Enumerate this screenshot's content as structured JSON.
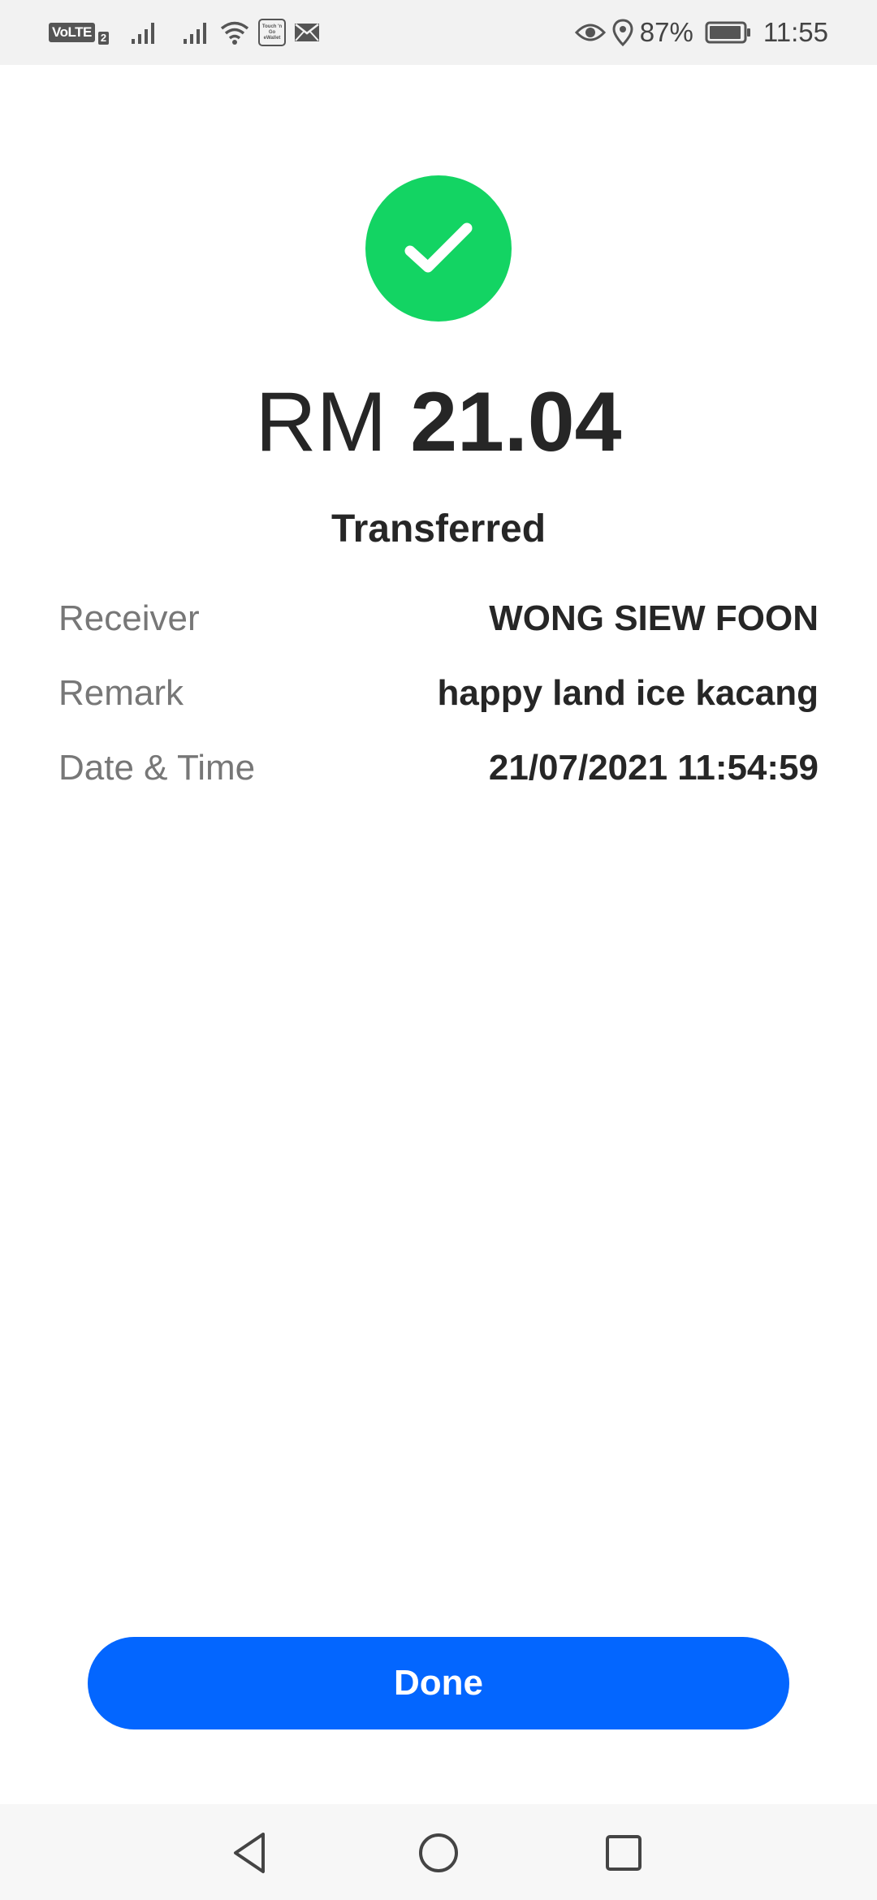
{
  "status_bar": {
    "volte": "VoLTE",
    "sim_slot": "2",
    "tng_label": "Touch 'n Go eWallet",
    "battery": "87%",
    "time": "11:55"
  },
  "transaction": {
    "currency": "RM",
    "amount": "21.04",
    "status": "Transferred"
  },
  "details": [
    {
      "label": "Receiver",
      "value": "WONG SIEW FOON"
    },
    {
      "label": "Remark",
      "value": "happy land ice kacang"
    },
    {
      "label": "Date & Time",
      "value": "21/07/2021 11:54:59"
    }
  ],
  "done_label": "Done",
  "colors": {
    "success": "#13d463",
    "primary": "#0366ff"
  },
  "icons": {
    "success": "check-icon",
    "back": "back-icon",
    "home": "home-icon",
    "recents": "recents-icon"
  }
}
